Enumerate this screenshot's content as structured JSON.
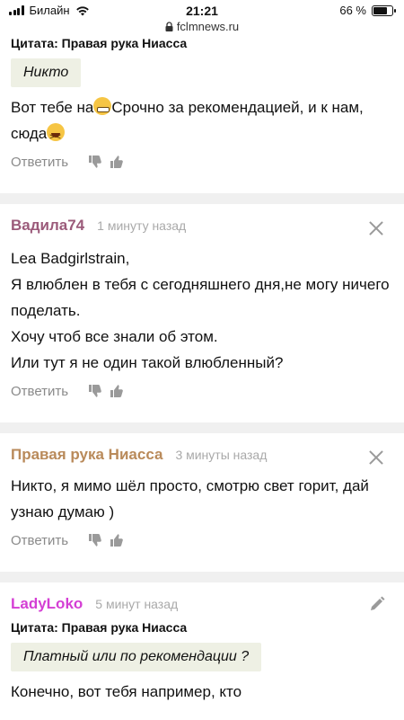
{
  "status": {
    "carrier": "Билайн",
    "time": "21:21",
    "battery": "66 %",
    "battery_level": 0.66
  },
  "url": "fclmnews.ru",
  "top_comment": {
    "quote_author": "Цитата: Правая рука Ниасса",
    "quote_text": "Никто",
    "text_part1": "Вот тебе на",
    "text_part2": "Срочно за рекомендацией, и к нам, сюда",
    "reply": "Ответить"
  },
  "comments": [
    {
      "author": "Вадила74",
      "author_color": "#9b5a7a",
      "time": "1 минуту назад",
      "lines": [
        "Lea Badgirlstrain,",
        "Я влюблен в тебя с сегодняшнего дня,не могу ничего поделать.",
        "Хочу чтоб все знали об этом.",
        "Или тут я не один такой влюбленный?"
      ],
      "reply": "Ответить"
    },
    {
      "author": "Правая рука Ниасса",
      "author_color": "#b98a5a",
      "time": "3 минуты назад",
      "text": "Никто, я мимо шёл просто, смотрю свет горит, дай узнаю думаю )",
      "reply": "Ответить"
    },
    {
      "author": "LadyLoko",
      "author_color": "#d43fd4",
      "time": "5 минут назад",
      "quote_author": "Цитата: Правая рука Ниасса",
      "quote_text": "Платный или по рекомендации ?",
      "text": "Конечно, вот тебя например, кто"
    }
  ]
}
